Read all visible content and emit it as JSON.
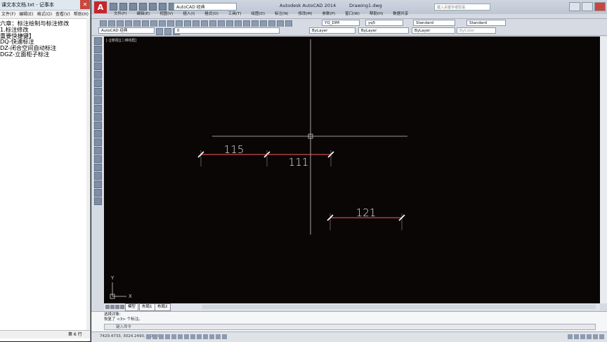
{
  "notepad": {
    "title": "课文本文档.txt - 记事本",
    "menu": [
      "文件(F)",
      "编辑(E)",
      "格式(O)",
      "查看(V)",
      "帮助(H)"
    ],
    "lines": [
      "六章：标注绘制与标注修改",
      "1.标注修改",
      "重要快捷键】",
      "DQ-快速标注",
      "DZ-闭合空间自动标注",
      "DGZ-立面柜子标注"
    ],
    "status": "第 6 行"
  },
  "acad": {
    "logo": "A",
    "workspace": "AutoCAD 经典",
    "app_title": "Autodesk AutoCAD 2014",
    "drawing_title": "Drawing1.dwg",
    "search_placeholder": "键入关键字或短语",
    "menu": [
      "文件(F)",
      "编辑(E)",
      "视图(V)",
      "插入(I)",
      "格式(O)",
      "工具(T)",
      "绘图(D)",
      "标注(N)",
      "修改(M)",
      "参数(P)",
      "窗口(W)",
      "帮助(H)",
      "数据共享"
    ],
    "toolbar": {
      "dimstyle": "YQ_DIM",
      "layerstyle": "yq5",
      "textstyle": "Standard",
      "tablestyle": "Standard",
      "workspace2": "AutoCAD 经典",
      "layer": "0",
      "color": "ByLayer",
      "linetype": "ByLayer",
      "lineweight": "ByLayer",
      "plotstyle": "ByColor"
    },
    "viewport_label": "[-][俯视][二维线框]",
    "ucs": {
      "x": "X",
      "y": "Y"
    },
    "tabs": [
      "模型",
      "布局1",
      "布局2"
    ],
    "command_history": [
      "选择对象:",
      "恢复了 <3> 个标注。"
    ],
    "command_prompt": "键入命令",
    "coordinates": "7429.4733, 3024.2490, 0.0000",
    "dimensions": [
      {
        "label": "115",
        "value": 115
      },
      {
        "label": "111",
        "value": 111
      },
      {
        "label": "121",
        "value": 121
      }
    ]
  },
  "colors": {
    "canvas": "#0a0606",
    "dim_line": "#ff5a5a",
    "crosshair": "#c8c8c8"
  }
}
